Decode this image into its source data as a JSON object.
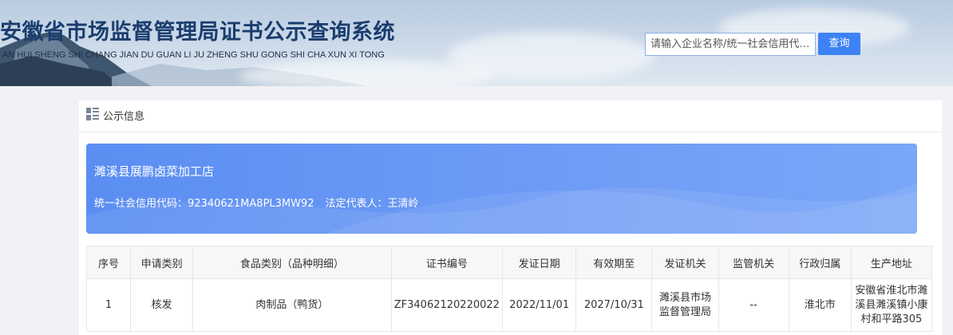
{
  "header": {
    "title": "安徽省市场监督管理局证书公示查询系统",
    "subtitle": "AN HUI SHENG SHI CHANG JIAN DU GUAN LI JU ZHENG SHU GONG SHI CHA XUN XI TONG",
    "search_placeholder": "请输入企业名称/统一社会信用代码...",
    "search_button": "查询"
  },
  "panel": {
    "title": "公示信息",
    "icon": "list-icon"
  },
  "company": {
    "name": "濉溪县展鹏卤菜加工店",
    "credit_code_label": "统一社会信用代码：",
    "credit_code": "92340621MA8PL3MW92",
    "legal_rep_label": "法定代表人：",
    "legal_rep": "王清岭"
  },
  "table": {
    "headers": [
      "序号",
      "申请类别",
      "食品类别（品种明细）",
      "证书编号",
      "发证日期",
      "有效期至",
      "发证机关",
      "监管机关",
      "行政归属",
      "生产地址"
    ],
    "rows": [
      [
        "1",
        "核发",
        "肉制品（鸭货）",
        "ZF34062120220022",
        "2022/11/01",
        "2027/10/31",
        "濉溪县市场监督管理局",
        "--",
        "淮北市",
        "安徽省淮北市濉溪县濉溪镇小康村和平路305"
      ]
    ]
  },
  "colors": {
    "accent": "#3d82f5",
    "card": "#6a9af5",
    "title": "#1b3d6e"
  }
}
